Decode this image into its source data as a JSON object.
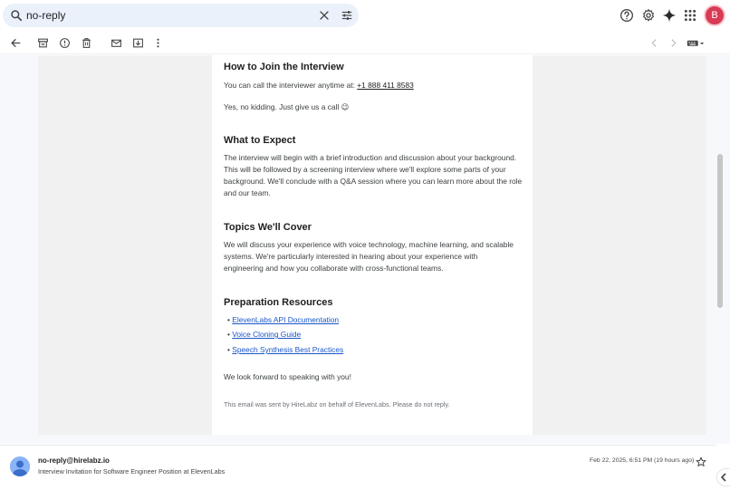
{
  "search": {
    "value": "no-reply"
  },
  "avatar": {
    "letter": "B",
    "color": "#d93a54"
  },
  "email": {
    "sections": [
      {
        "heading": "How to Join the Interview",
        "call_text": "You can call the interviewer anytime at: ",
        "phone": "+1 888 411 8583",
        "joke": "Yes, no kidding. Just give us a call 😉"
      },
      {
        "heading": "What to Expect",
        "body": "The interview will begin with a brief introduction and discussion about your background. This will be followed by a screening interview where we'll explore some parts of your background. We'll conclude with a Q&A session where you can learn more about the role and our team."
      },
      {
        "heading": "Topics We'll Cover",
        "body": "We will discuss your experience with voice technology, machine learning, and scalable systems. We're particularly interested in hearing about your experience with engineering and how you collaborate with cross-functional teams."
      },
      {
        "heading": "Preparation Resources",
        "links": [
          "ElevenLabs API Documentation",
          "Voice Cloning Guide",
          "Speech Synthesis Best Practices"
        ]
      }
    ],
    "closing": "We look forward to speaking with you!",
    "footer": "This email was sent by HireLabz on behalf of ElevenLabs. Please do not reply."
  },
  "message_row": {
    "sender": "no-reply@hirelabz.io",
    "subject": "Interview Invitation for Software Engineer Position at ElevenLabs",
    "date": "Feb 22, 2025, 6:51 PM (19 hours ago)"
  },
  "colors": {
    "accent": "#1a56c9",
    "search_bg": "#eaf1fb",
    "panel_bg": "#f1f1f1"
  },
  "icons": {
    "search": "search-icon",
    "clear": "close-icon",
    "tune": "tune-icon",
    "help": "help-icon",
    "settings": "gear-icon",
    "gemini": "sparkle-icon",
    "apps": "apps-grid-icon",
    "back": "arrow-back-icon",
    "archive": "archive-icon",
    "spam": "report-spam-icon",
    "delete": "trash-icon",
    "unread": "mark-unread-icon",
    "move": "move-to-icon",
    "more": "more-vert-icon",
    "prev": "chevron-left-icon",
    "next": "chevron-right-icon",
    "input_tools": "keyboard-icon",
    "star": "star-icon"
  }
}
